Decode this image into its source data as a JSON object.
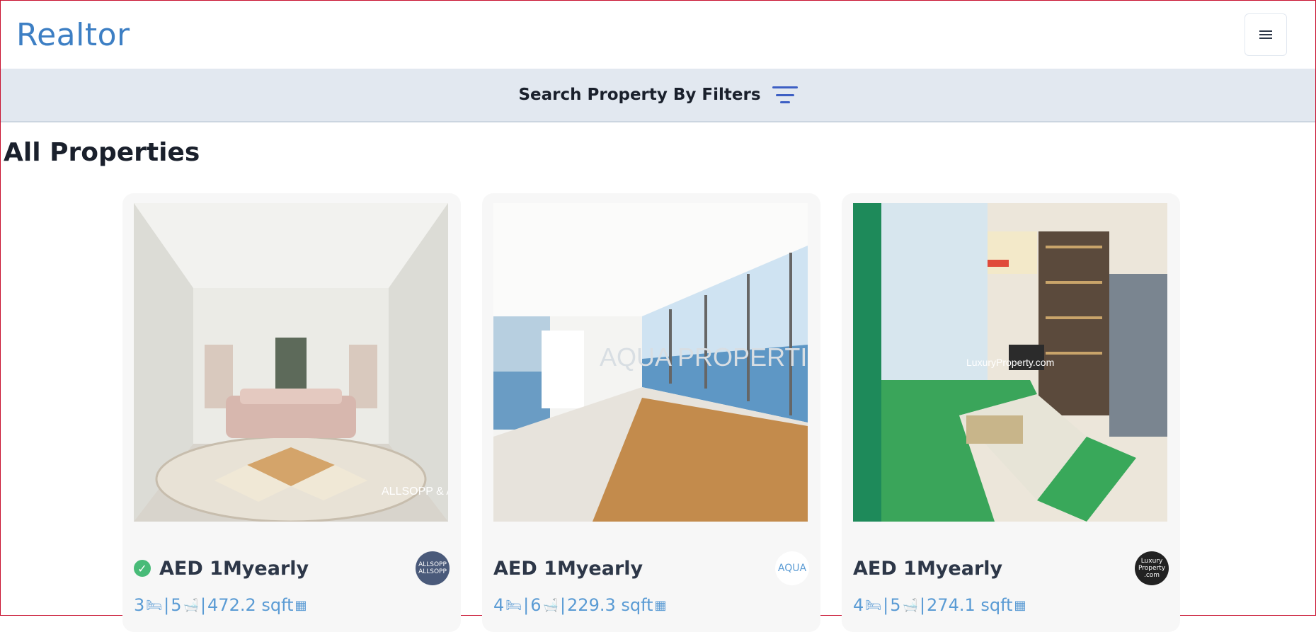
{
  "navbar": {
    "brand": "Realtor"
  },
  "filter": {
    "label": "Search Property By Filters"
  },
  "section": {
    "title": "All Properties"
  },
  "properties": [
    {
      "verified": true,
      "price": "AED 1Myearly",
      "rooms": "3",
      "baths": "5",
      "area": "472.2 sqft",
      "agency": "ALLSOPP ALLSOPP",
      "agency_color": "#4a5a7a",
      "watermark": "ALLSOPP & ALLSOPP"
    },
    {
      "verified": false,
      "price": "AED 1Myearly",
      "rooms": "4",
      "baths": "6",
      "area": "229.3 sqft",
      "agency": "AQUA",
      "agency_color": "#ffffff",
      "watermark": "AQUA PROPERTIES"
    },
    {
      "verified": false,
      "price": "AED 1Myearly",
      "rooms": "4",
      "baths": "5",
      "area": "274.1 sqft",
      "agency": "Luxury Property .com",
      "agency_color": "#222222",
      "watermark": "LuxuryProperty.com"
    }
  ],
  "colors": {
    "accent": "#3d7fc4",
    "stats": "#5a9bd4",
    "filter_bg": "#e2e8f0"
  }
}
